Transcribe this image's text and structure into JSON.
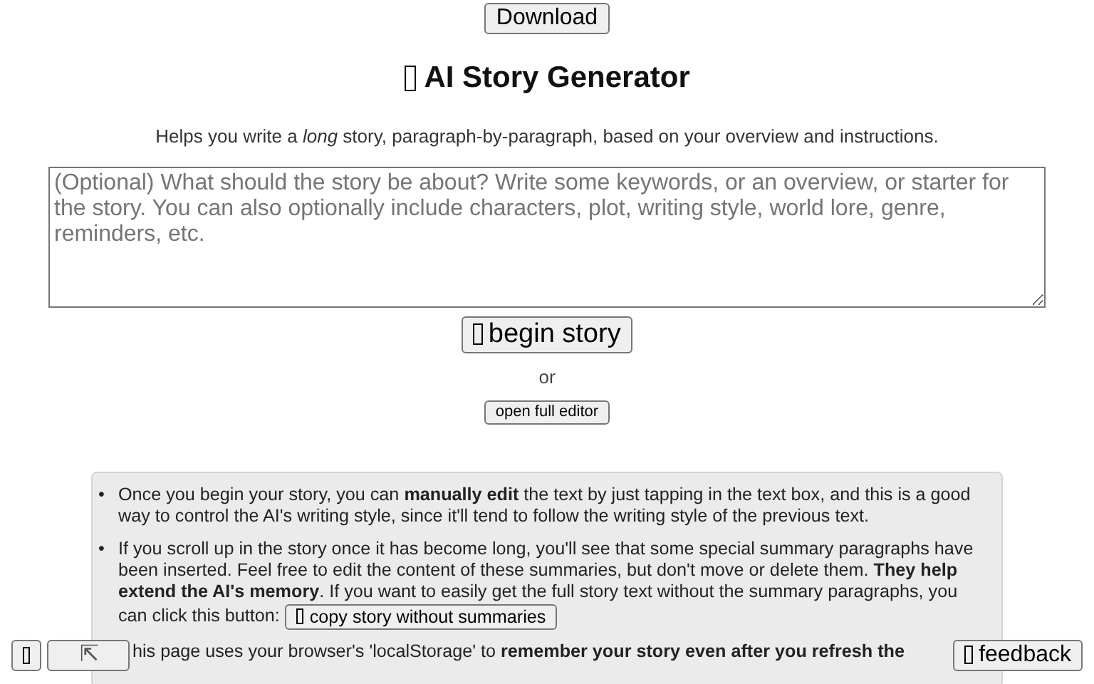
{
  "download_button": "Download",
  "title": "AI Story Generator",
  "subtitle": "Helps you write a *long* story, paragraph-by-paragraph, based on your overview and instructions.",
  "overview_field": {
    "placeholder": "(Optional) What should the story be about? Write some keywords, or an overview, or starter for the story. You can also optionally include characters, plot, writing style, world lore, genre, reminders, etc."
  },
  "begin_button": "begin story",
  "separator": "or",
  "full_editor_button": "open full editor",
  "notes": [
    {
      "marker": "•",
      "text": "Once you begin your story, you can **manually edit** the text by just tapping in the text box, and this is a good way to control the AI's writing style, since it'll tend to follow the writing style of the previous text."
    },
    {
      "marker": "•",
      "text": "If you scroll up in the story once it has become long, you'll see that some special summary paragraphs have been inserted. Feel free to edit the content of these summaries, but don't move or delete them. **They help extend the AI's memory**. If you want to easily get the full story text without the summary paragraphs, you",
      "button_lead": "can click this button:",
      "button": "copy story without summaries"
    },
    {
      "text": "his page uses your browser's 'localStorage' to **remember your story even after you refresh the**"
    }
  ],
  "scroll_top_button": "⇱",
  "feedback_button": "feedback"
}
